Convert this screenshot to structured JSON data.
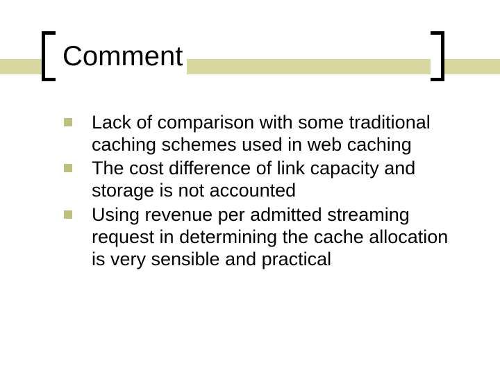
{
  "title": "Comment",
  "bullets": [
    "Lack of comparison with some traditional caching schemes used in web caching",
    "The cost difference of link capacity and storage is not accounted",
    "Using revenue per admitted streaming request in determining the cache allocation is very sensible and practical"
  ]
}
